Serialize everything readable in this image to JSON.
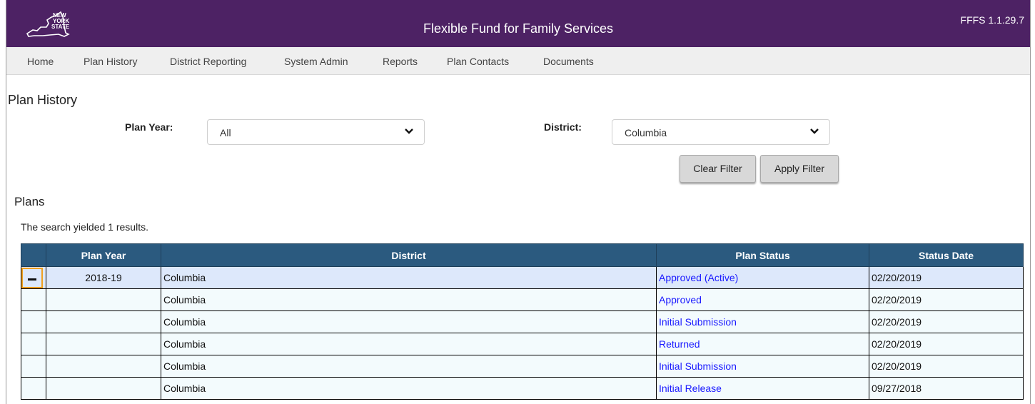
{
  "app": {
    "title": "Flexible Fund for Family Services",
    "version": "FFFS 1.1.29.7",
    "logo_text": [
      "NEW",
      "YORK",
      "STATE"
    ]
  },
  "nav": [
    "Home",
    "Plan History",
    "District Reporting",
    "System Admin",
    "Reports",
    "Plan Contacts",
    "Documents"
  ],
  "page": {
    "title": "Plan History"
  },
  "filters": {
    "plan_year_label": "Plan Year:",
    "plan_year_value": "All",
    "district_label": "District:",
    "district_value": "Columbia",
    "clear_label": "Clear Filter",
    "apply_label": "Apply Filter"
  },
  "plans": {
    "title": "Plans",
    "results_text": "The search yielded 1 results.",
    "headers": [
      "",
      "Plan Year",
      "District",
      "Plan Status",
      "Status Date"
    ],
    "rows": [
      {
        "plan_year": "2018-19",
        "district": "Columbia",
        "status": "Approved (Active)",
        "date": "02/20/2019"
      },
      {
        "plan_year": "",
        "district": "Columbia",
        "status": "Approved",
        "date": "02/20/2019"
      },
      {
        "plan_year": "",
        "district": "Columbia",
        "status": "Initial Submission",
        "date": "02/20/2019"
      },
      {
        "plan_year": "",
        "district": "Columbia",
        "status": "Returned",
        "date": "02/20/2019"
      },
      {
        "plan_year": "",
        "district": "Columbia",
        "status": "Initial Submission",
        "date": "02/20/2019"
      },
      {
        "plan_year": "",
        "district": "Columbia",
        "status": "Initial Release",
        "date": "09/27/2018"
      }
    ]
  },
  "colors": {
    "header_bar": "#4d2264",
    "table_header": "#2b5a7f",
    "link": "#1a1aff",
    "selected_row": "#dde8fb"
  }
}
